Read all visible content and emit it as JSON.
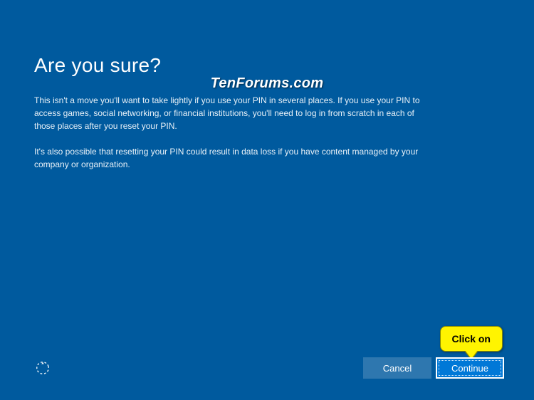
{
  "dialog": {
    "title": "Are you sure?",
    "paragraph1": "This isn't a move you'll want to take lightly if you use your PIN in several places. If you use your PIN to access games, social networking, or financial institutions, you'll need to log in from scratch in each of those places after you reset your PIN.",
    "paragraph2": "It's also possible that resetting your PIN could result in data loss if you have content managed by your company or organization."
  },
  "watermark": "TenForums.com",
  "buttons": {
    "cancel": "Cancel",
    "continue": "Continue"
  },
  "callout": {
    "text": "Click on"
  },
  "colors": {
    "background": "#005a9e",
    "continueButton": "#0078d7",
    "callout": "#fff400"
  }
}
